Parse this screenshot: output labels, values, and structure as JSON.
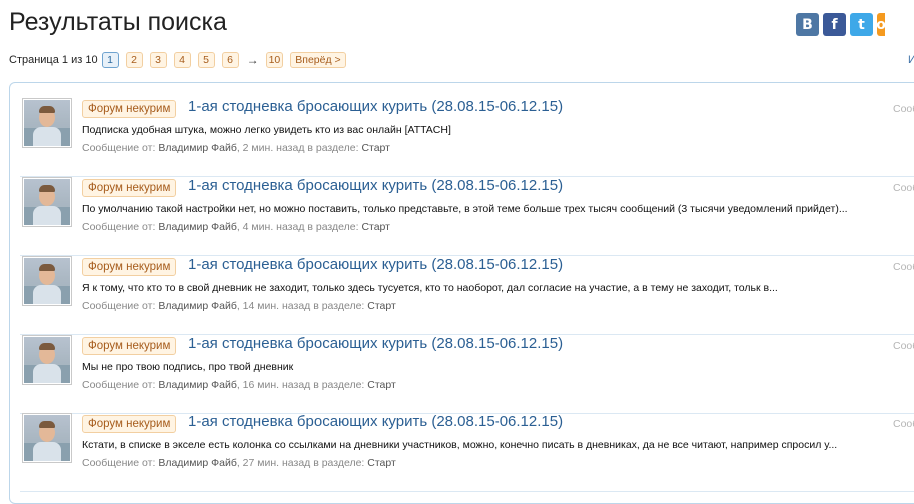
{
  "page": {
    "title": "Результаты поиска"
  },
  "social": {
    "vk": "В",
    "fb": "f",
    "tw": "t",
    "ok": "о",
    "colors": {
      "vk": "#4e77a4",
      "fb": "#3b5998",
      "tw": "#3ea8e8",
      "ok": "#f59a1f"
    }
  },
  "pager": {
    "label": "Страница 1 из 10",
    "pages": [
      "1",
      "2",
      "3",
      "4",
      "5",
      "6"
    ],
    "arrow": "→",
    "last": "10",
    "next": "Вперёд >",
    "corner": "И"
  },
  "results": [
    {
      "badge": "Форум некурим",
      "title": "1-ая стодневка бросающих курить (28.08.15-06.12.15)",
      "snippet": "Подписка удобная штука, можно легко увидеть кто из вас онлайн [ATTACH]",
      "meta_prefix": "Сообщение от:",
      "author": "Владимир Файб",
      "time": ", 2 мин. назад в разделе:",
      "section": "Старт",
      "type": "Сообщ"
    },
    {
      "badge": "Форум некурим",
      "title": "1-ая стодневка бросающих курить (28.08.15-06.12.15)",
      "snippet": "По умолчанию такой настройки нет, но можно поставить, только представьте, в этой теме больше трех тысяч сообщений (3 тысячи уведомлений прийдет)...",
      "meta_prefix": "Сообщение от:",
      "author": "Владимир Файб",
      "time": ", 4 мин. назад в разделе:",
      "section": "Старт",
      "type": "Сообщ"
    },
    {
      "badge": "Форум некурим",
      "title": "1-ая стодневка бросающих курить (28.08.15-06.12.15)",
      "snippet": "Я к тому, что кто то в свой дневник не заходит, только здесь тусуется, кто то наоборот, дал согласие на участие, а в тему не заходит, тольк в...",
      "meta_prefix": "Сообщение от:",
      "author": "Владимир Файб",
      "time": ", 14 мин. назад в разделе:",
      "section": "Старт",
      "type": "Сообщ"
    },
    {
      "badge": "Форум некурим",
      "title": "1-ая стодневка бросающих курить (28.08.15-06.12.15)",
      "snippet": "Мы не про твою подпись, про твой дневник",
      "meta_prefix": "Сообщение от:",
      "author": "Владимир Файб",
      "time": ", 16 мин. назад в разделе:",
      "section": "Старт",
      "type": "Сообщ"
    },
    {
      "badge": "Форум некурим",
      "title": "1-ая стодневка бросающих курить (28.08.15-06.12.15)",
      "snippet": "Кстати, в списке в экселе есть колонка со ссылками на дневники участников, можно, конечно писать в дневниках, да не все читают, например спросил у...",
      "meta_prefix": "Сообщение от:",
      "author": "Владимир Файб",
      "time": ", 27 мин. назад в разделе:",
      "section": "Старт",
      "type": "Сообщ"
    }
  ]
}
